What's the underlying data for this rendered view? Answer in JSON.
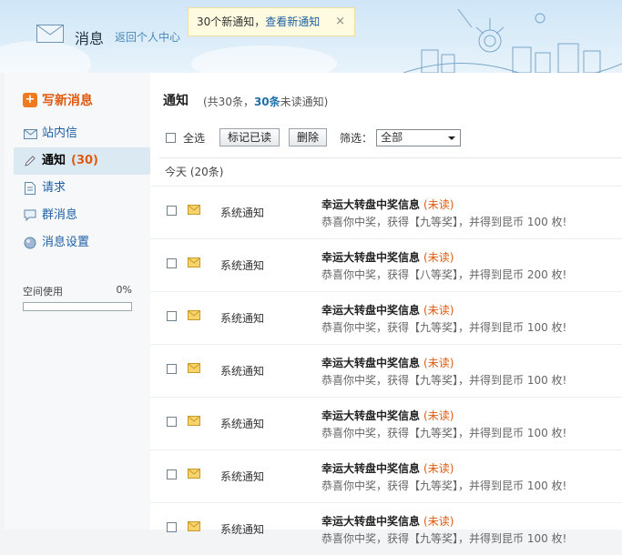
{
  "header": {
    "title": "消息",
    "back_link": "返回个人中心",
    "notification": {
      "prefix": "30个新通知，",
      "link": "查看新通知",
      "close": "×"
    }
  },
  "sidebar": {
    "compose_label": "写新消息",
    "items": [
      {
        "label": "站内信",
        "icon": "envelope-icon",
        "count": ""
      },
      {
        "label": "通知",
        "icon": "pencil-icon",
        "count": "(30)",
        "active": true
      },
      {
        "label": "请求",
        "icon": "document-icon",
        "count": ""
      },
      {
        "label": "群消息",
        "icon": "chat-icon",
        "count": ""
      },
      {
        "label": "消息设置",
        "icon": "settings-icon",
        "count": ""
      }
    ],
    "space": {
      "label": "空间使用",
      "percent": "0%",
      "fill_fraction": 0
    }
  },
  "main": {
    "title": "通知",
    "summary": {
      "pre": "(共30条，",
      "unread_count": "30条",
      "post": "未读通知)"
    },
    "toolbar": {
      "select_all": "全选",
      "mark_read": "标记已读",
      "delete": "删除",
      "filter_label": "筛选：",
      "filter_value": "全部"
    },
    "group_label": "今天 (20条)",
    "rows": [
      {
        "sender": "系统通知",
        "subject": "幸运大转盘中奖信息",
        "status": "(未读)",
        "preview": "恭喜你中奖，获得【九等奖】，并得到昆币 100 枚!"
      },
      {
        "sender": "系统通知",
        "subject": "幸运大转盘中奖信息",
        "status": "(未读)",
        "preview": "恭喜你中奖，获得【八等奖】，并得到昆币 200 枚!"
      },
      {
        "sender": "系统通知",
        "subject": "幸运大转盘中奖信息",
        "status": "(未读)",
        "preview": "恭喜你中奖，获得【九等奖】，并得到昆币 100 枚!"
      },
      {
        "sender": "系统通知",
        "subject": "幸运大转盘中奖信息",
        "status": "(未读)",
        "preview": "恭喜你中奖，获得【九等奖】，并得到昆币 100 枚!"
      },
      {
        "sender": "系统通知",
        "subject": "幸运大转盘中奖信息",
        "status": "(未读)",
        "preview": "恭喜你中奖，获得【九等奖】，并得到昆币 100 枚!"
      },
      {
        "sender": "系统通知",
        "subject": "幸运大转盘中奖信息",
        "status": "(未读)",
        "preview": "恭喜你中奖，获得【九等奖】，并得到昆币 100 枚!"
      },
      {
        "sender": "系统通知",
        "subject": "幸运大转盘中奖信息",
        "status": "(未读)",
        "preview": "恭喜你中奖，获得【九等奖】，并得到昆币 100 枚!"
      }
    ]
  },
  "colors": {
    "accent": "#e05a10",
    "link": "#1f5fa4",
    "header_bg": "#cfe6f7"
  }
}
